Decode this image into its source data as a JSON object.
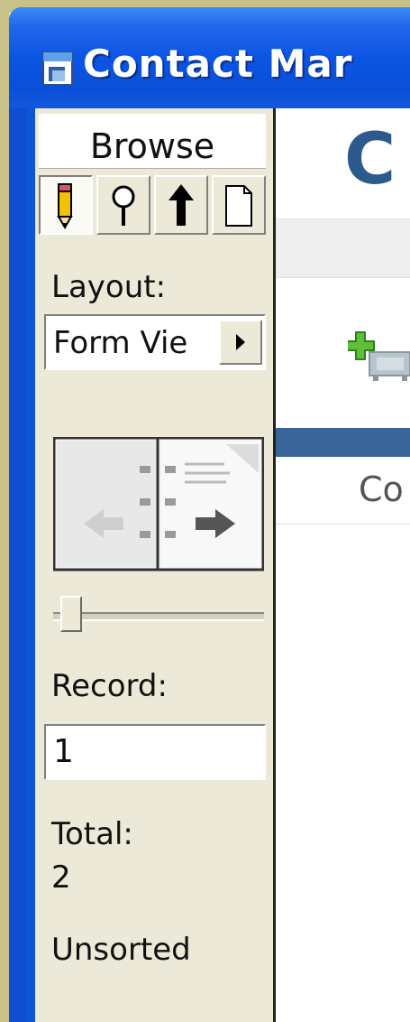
{
  "window": {
    "title": "Contact Mar"
  },
  "sidebar": {
    "mode": "Browse",
    "tools": [
      {
        "icon": "pencil-icon"
      },
      {
        "icon": "magnifier-icon"
      },
      {
        "icon": "sort-arrow-icon"
      },
      {
        "icon": "page-icon"
      }
    ],
    "layout_label": "Layout:",
    "layout_value": "Form Vie",
    "record_label": "Record:",
    "record_value": "1",
    "total_label": "Total:",
    "total_value": "2",
    "sort_status": "Unsorted"
  },
  "content": {
    "heading": "C",
    "column_header": "Co"
  },
  "colors": {
    "titlebar": "#0b55e4",
    "heading": "#2d5a8c",
    "band": "#3a6598",
    "sidebar_bg": "#ece9d8"
  }
}
